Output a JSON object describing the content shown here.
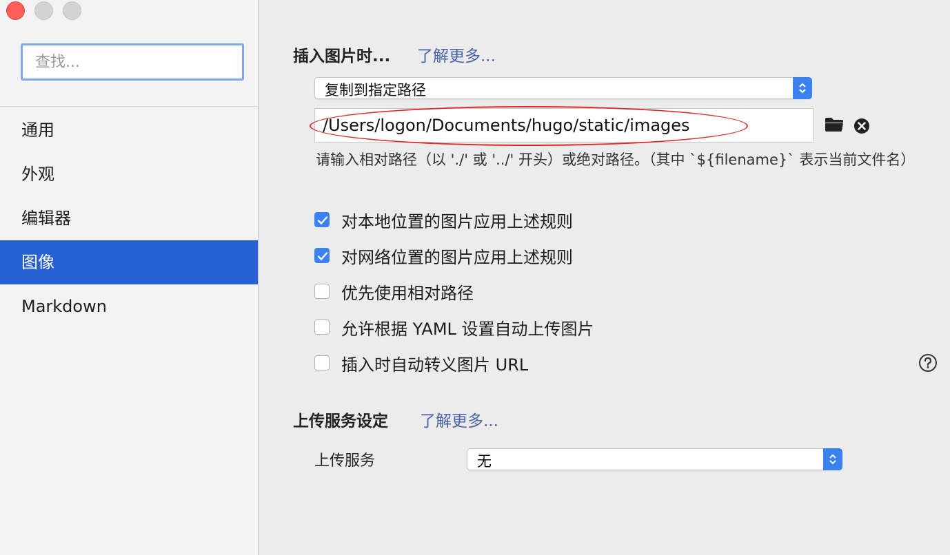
{
  "sidebar": {
    "search_placeholder": "查找...",
    "items": [
      {
        "label": "通用"
      },
      {
        "label": "外观"
      },
      {
        "label": "编辑器"
      },
      {
        "label": "图像"
      },
      {
        "label": "Markdown"
      }
    ],
    "selected": "图像",
    "selected_color": "#2660d6"
  },
  "insert_image": {
    "title": "插入图片时...",
    "learn_more": "了解更多...",
    "action_select": "复制到指定路径",
    "path_value": "/Users/logon/Documents/hugo/static/images",
    "hint": "请输入相对路径（以 './' 或 '../' 开头）或绝对路径。（其中 `${filename}` 表示当前文件名）",
    "options": [
      {
        "label": "对本地位置的图片应用上述规则",
        "checked": true
      },
      {
        "label": "对网络位置的图片应用上述规则",
        "checked": true
      },
      {
        "label": "优先使用相对路径",
        "checked": false
      },
      {
        "label": "允许根据 YAML 设置自动上传图片",
        "checked": false
      },
      {
        "label": "插入时自动转义图片 URL",
        "checked": false
      }
    ],
    "icons": [
      "folder-icon",
      "clear-icon",
      "help-icon"
    ]
  },
  "upload": {
    "title": "上传服务设定",
    "learn_more": "了解更多...",
    "service_label": "上传服务",
    "service_value": "无"
  },
  "colors": {
    "accent": "#3b82f0",
    "link": "#4a62a8",
    "annotation_ellipse": "#e12828"
  }
}
